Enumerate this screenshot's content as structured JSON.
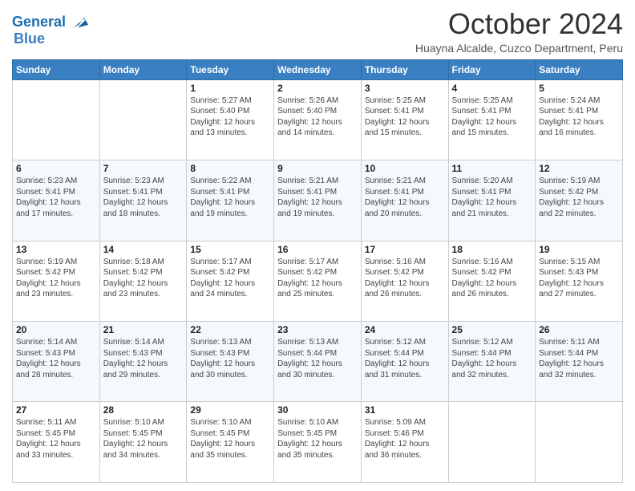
{
  "header": {
    "logo_line1": "General",
    "logo_line2": "Blue",
    "month": "October 2024",
    "location": "Huayna Alcalde, Cuzco Department, Peru"
  },
  "days_of_week": [
    "Sunday",
    "Monday",
    "Tuesday",
    "Wednesday",
    "Thursday",
    "Friday",
    "Saturday"
  ],
  "weeks": [
    [
      {
        "day": "",
        "info": ""
      },
      {
        "day": "",
        "info": ""
      },
      {
        "day": "1",
        "info": "Sunrise: 5:27 AM\nSunset: 5:40 PM\nDaylight: 12 hours and 13 minutes."
      },
      {
        "day": "2",
        "info": "Sunrise: 5:26 AM\nSunset: 5:40 PM\nDaylight: 12 hours and 14 minutes."
      },
      {
        "day": "3",
        "info": "Sunrise: 5:25 AM\nSunset: 5:41 PM\nDaylight: 12 hours and 15 minutes."
      },
      {
        "day": "4",
        "info": "Sunrise: 5:25 AM\nSunset: 5:41 PM\nDaylight: 12 hours and 15 minutes."
      },
      {
        "day": "5",
        "info": "Sunrise: 5:24 AM\nSunset: 5:41 PM\nDaylight: 12 hours and 16 minutes."
      }
    ],
    [
      {
        "day": "6",
        "info": "Sunrise: 5:23 AM\nSunset: 5:41 PM\nDaylight: 12 hours and 17 minutes."
      },
      {
        "day": "7",
        "info": "Sunrise: 5:23 AM\nSunset: 5:41 PM\nDaylight: 12 hours and 18 minutes."
      },
      {
        "day": "8",
        "info": "Sunrise: 5:22 AM\nSunset: 5:41 PM\nDaylight: 12 hours and 19 minutes."
      },
      {
        "day": "9",
        "info": "Sunrise: 5:21 AM\nSunset: 5:41 PM\nDaylight: 12 hours and 19 minutes."
      },
      {
        "day": "10",
        "info": "Sunrise: 5:21 AM\nSunset: 5:41 PM\nDaylight: 12 hours and 20 minutes."
      },
      {
        "day": "11",
        "info": "Sunrise: 5:20 AM\nSunset: 5:41 PM\nDaylight: 12 hours and 21 minutes."
      },
      {
        "day": "12",
        "info": "Sunrise: 5:19 AM\nSunset: 5:42 PM\nDaylight: 12 hours and 22 minutes."
      }
    ],
    [
      {
        "day": "13",
        "info": "Sunrise: 5:19 AM\nSunset: 5:42 PM\nDaylight: 12 hours and 23 minutes."
      },
      {
        "day": "14",
        "info": "Sunrise: 5:18 AM\nSunset: 5:42 PM\nDaylight: 12 hours and 23 minutes."
      },
      {
        "day": "15",
        "info": "Sunrise: 5:17 AM\nSunset: 5:42 PM\nDaylight: 12 hours and 24 minutes."
      },
      {
        "day": "16",
        "info": "Sunrise: 5:17 AM\nSunset: 5:42 PM\nDaylight: 12 hours and 25 minutes."
      },
      {
        "day": "17",
        "info": "Sunrise: 5:16 AM\nSunset: 5:42 PM\nDaylight: 12 hours and 26 minutes."
      },
      {
        "day": "18",
        "info": "Sunrise: 5:16 AM\nSunset: 5:42 PM\nDaylight: 12 hours and 26 minutes."
      },
      {
        "day": "19",
        "info": "Sunrise: 5:15 AM\nSunset: 5:43 PM\nDaylight: 12 hours and 27 minutes."
      }
    ],
    [
      {
        "day": "20",
        "info": "Sunrise: 5:14 AM\nSunset: 5:43 PM\nDaylight: 12 hours and 28 minutes."
      },
      {
        "day": "21",
        "info": "Sunrise: 5:14 AM\nSunset: 5:43 PM\nDaylight: 12 hours and 29 minutes."
      },
      {
        "day": "22",
        "info": "Sunrise: 5:13 AM\nSunset: 5:43 PM\nDaylight: 12 hours and 30 minutes."
      },
      {
        "day": "23",
        "info": "Sunrise: 5:13 AM\nSunset: 5:44 PM\nDaylight: 12 hours and 30 minutes."
      },
      {
        "day": "24",
        "info": "Sunrise: 5:12 AM\nSunset: 5:44 PM\nDaylight: 12 hours and 31 minutes."
      },
      {
        "day": "25",
        "info": "Sunrise: 5:12 AM\nSunset: 5:44 PM\nDaylight: 12 hours and 32 minutes."
      },
      {
        "day": "26",
        "info": "Sunrise: 5:11 AM\nSunset: 5:44 PM\nDaylight: 12 hours and 32 minutes."
      }
    ],
    [
      {
        "day": "27",
        "info": "Sunrise: 5:11 AM\nSunset: 5:45 PM\nDaylight: 12 hours and 33 minutes."
      },
      {
        "day": "28",
        "info": "Sunrise: 5:10 AM\nSunset: 5:45 PM\nDaylight: 12 hours and 34 minutes."
      },
      {
        "day": "29",
        "info": "Sunrise: 5:10 AM\nSunset: 5:45 PM\nDaylight: 12 hours and 35 minutes."
      },
      {
        "day": "30",
        "info": "Sunrise: 5:10 AM\nSunset: 5:45 PM\nDaylight: 12 hours and 35 minutes."
      },
      {
        "day": "31",
        "info": "Sunrise: 5:09 AM\nSunset: 5:46 PM\nDaylight: 12 hours and 36 minutes."
      },
      {
        "day": "",
        "info": ""
      },
      {
        "day": "",
        "info": ""
      }
    ]
  ]
}
